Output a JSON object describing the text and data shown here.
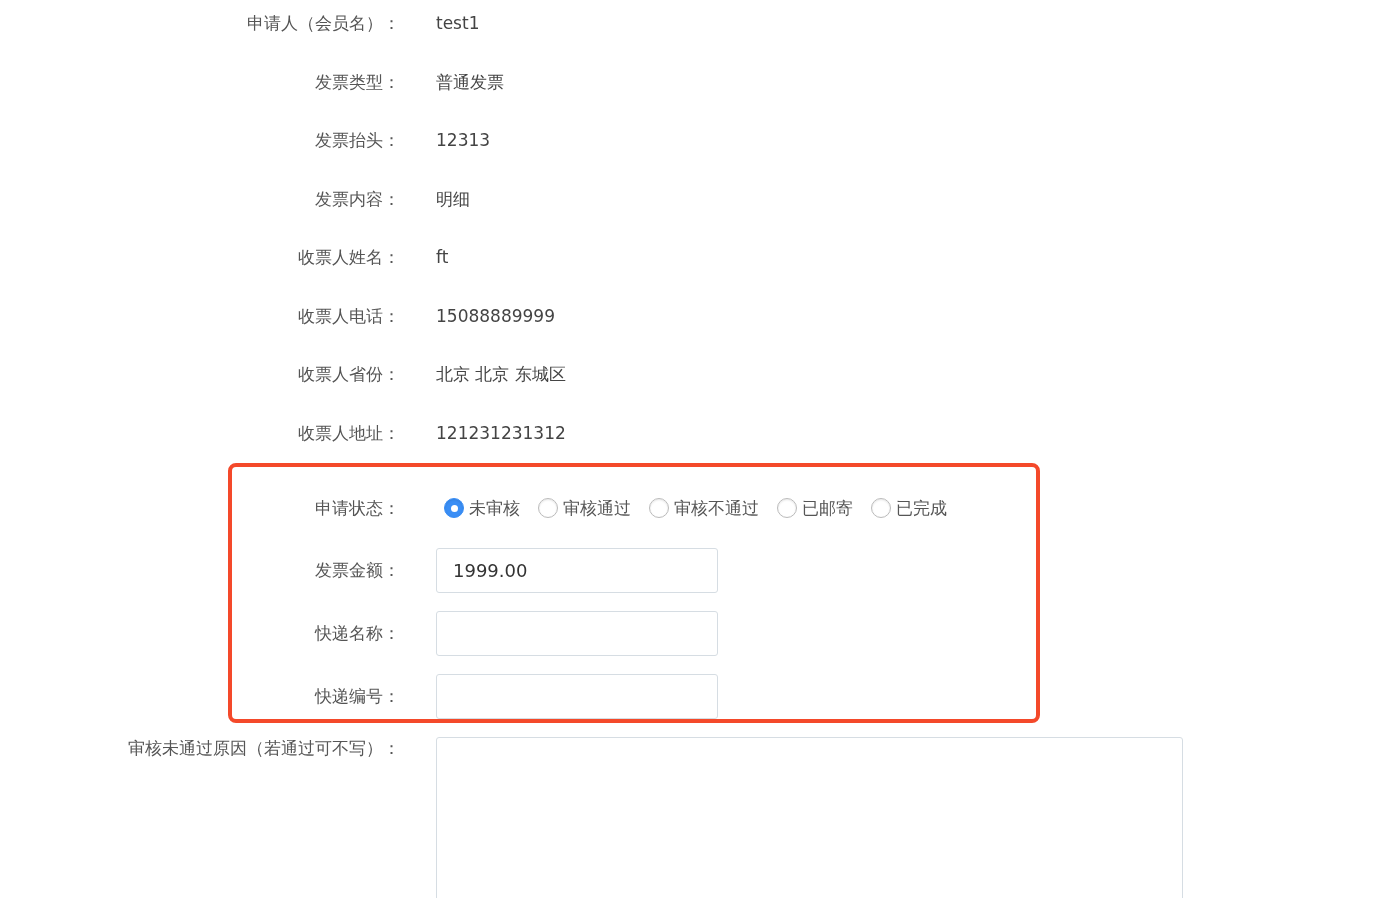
{
  "info_rows": [
    {
      "label": "申请人（会员名）：",
      "value": "test1"
    },
    {
      "label": "发票类型：",
      "value": "普通发票"
    },
    {
      "label": "发票抬头：",
      "value": "12313"
    },
    {
      "label": "发票内容：",
      "value": "明细"
    },
    {
      "label": "收票人姓名：",
      "value": "ft"
    },
    {
      "label": "收票人电话：",
      "value": "15088889999"
    },
    {
      "label": "收票人省份：",
      "value": "北京 北京 东城区"
    },
    {
      "label": "收票人地址：",
      "value": "121231231312"
    }
  ],
  "status": {
    "label": "申请状态：",
    "options": [
      {
        "label": "未审核",
        "selected": true
      },
      {
        "label": "审核通过",
        "selected": false
      },
      {
        "label": "审核不通过",
        "selected": false
      },
      {
        "label": "已邮寄",
        "selected": false
      },
      {
        "label": "已完成",
        "selected": false
      }
    ]
  },
  "fields": [
    {
      "label": "发票金额：",
      "value": "1999.00"
    },
    {
      "label": "快递名称："
    },
    {
      "label": "快递编号："
    }
  ],
  "reason": {
    "label": "审核未通过原因（若通过可不写）："
  }
}
